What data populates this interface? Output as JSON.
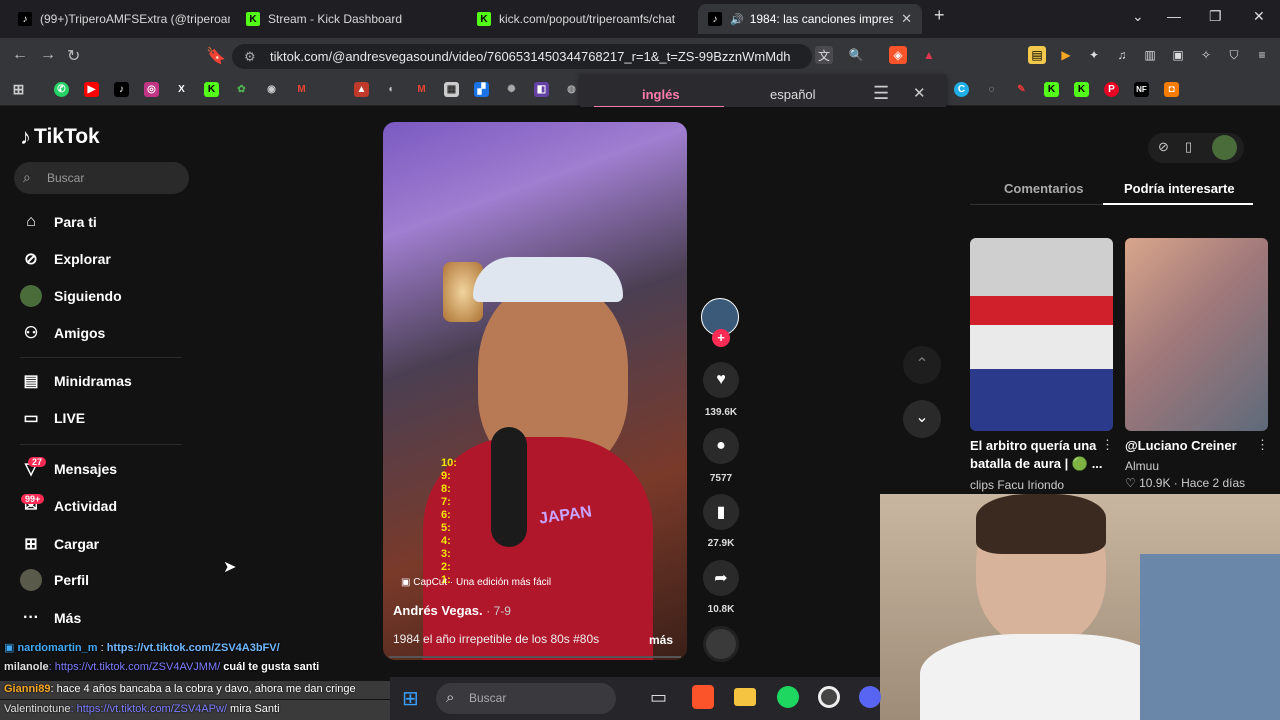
{
  "tabs": [
    {
      "title": "(99+)TriperoAMFSExtra (@triperoamf",
      "icon": "tiktok-icon"
    },
    {
      "title": "Stream - Kick Dashboard",
      "icon": "kick-icon"
    },
    {
      "title": "kick.com/popout/triperoamfs/chat",
      "icon": "kick-icon"
    },
    {
      "title": "1984: las canciones imprescin",
      "icon": "tiktok-icon"
    }
  ],
  "url": "tiktok.com/@andresvegasound/video/7606531450344768217_r=1&_t=ZS-99BzznWmMdh",
  "translate": {
    "lang1": "inglés",
    "lang2": "español"
  },
  "tiktok": {
    "logo": "TikTok",
    "search_placeholder": "Buscar",
    "nav": {
      "for_you": "Para ti",
      "explore": "Explorar",
      "following": "Siguiendo",
      "friends": "Amigos",
      "minidramas": "Minidramas",
      "live": "LIVE",
      "messages": "Mensajes",
      "messages_badge": "27",
      "activity": "Actividad",
      "activity_badge": "99+",
      "upload": "Cargar",
      "profile": "Perfil",
      "more": "Más"
    },
    "video": {
      "capcut": "CapCut · Una edición más fácil",
      "author": "Andrés Vegas.",
      "date": "· 7-9",
      "caption": "1984 el año irrepetible de los 80s #80s",
      "more": "más",
      "overlay_numbers": [
        "10:",
        "9:",
        "8:",
        "7:",
        "6:",
        "5:",
        "4:",
        "3:",
        "2:",
        "1:"
      ],
      "shirt_text": "JAPAN"
    },
    "actions": {
      "likes": "139.6K",
      "comments": "7577",
      "saves": "27.9K",
      "shares": "10.8K"
    },
    "panel_tabs": {
      "comments": "Comentarios",
      "recommended": "Podría interesarte"
    },
    "recommended": [
      {
        "title": "El arbitro quería una batalla de aura | 🟢 ...",
        "channel": "clips Facu Iriondo",
        "author": ""
      },
      {
        "title": "@Luciano Creiner",
        "channel": "Almuu",
        "likes": "10.9K",
        "time": "Hace 2 días"
      }
    ]
  },
  "chat": [
    {
      "user": "nardomartin_m",
      "user_color": "#3fa9f5",
      "text": "https://vt.tiktok.com/ZSV4A3bFV/",
      "text_color": "#6fb7ff"
    },
    {
      "user": "milanole",
      "user_color": "#e0e0e0",
      "text": ": https://vt.tiktok.com/ZSV4AVJMM/",
      "tail": " cuál te gusta santi",
      "text_color": "#7b7bff"
    },
    {
      "user": "Gianni89",
      "user_color": "#f5a623",
      "text": ": hace 4 años bancaba a la cobra y davo, ahora me dan cringe",
      "text_color": "#fff"
    },
    {
      "user": "Valentinotune",
      "user_color": "#e0e0e0",
      "text": ": https://vt.tiktok.com/ZSV4APw/",
      "tail": " mira Santi",
      "text_color": "#7b7bff"
    }
  ],
  "taskbar": {
    "search": "Buscar"
  }
}
